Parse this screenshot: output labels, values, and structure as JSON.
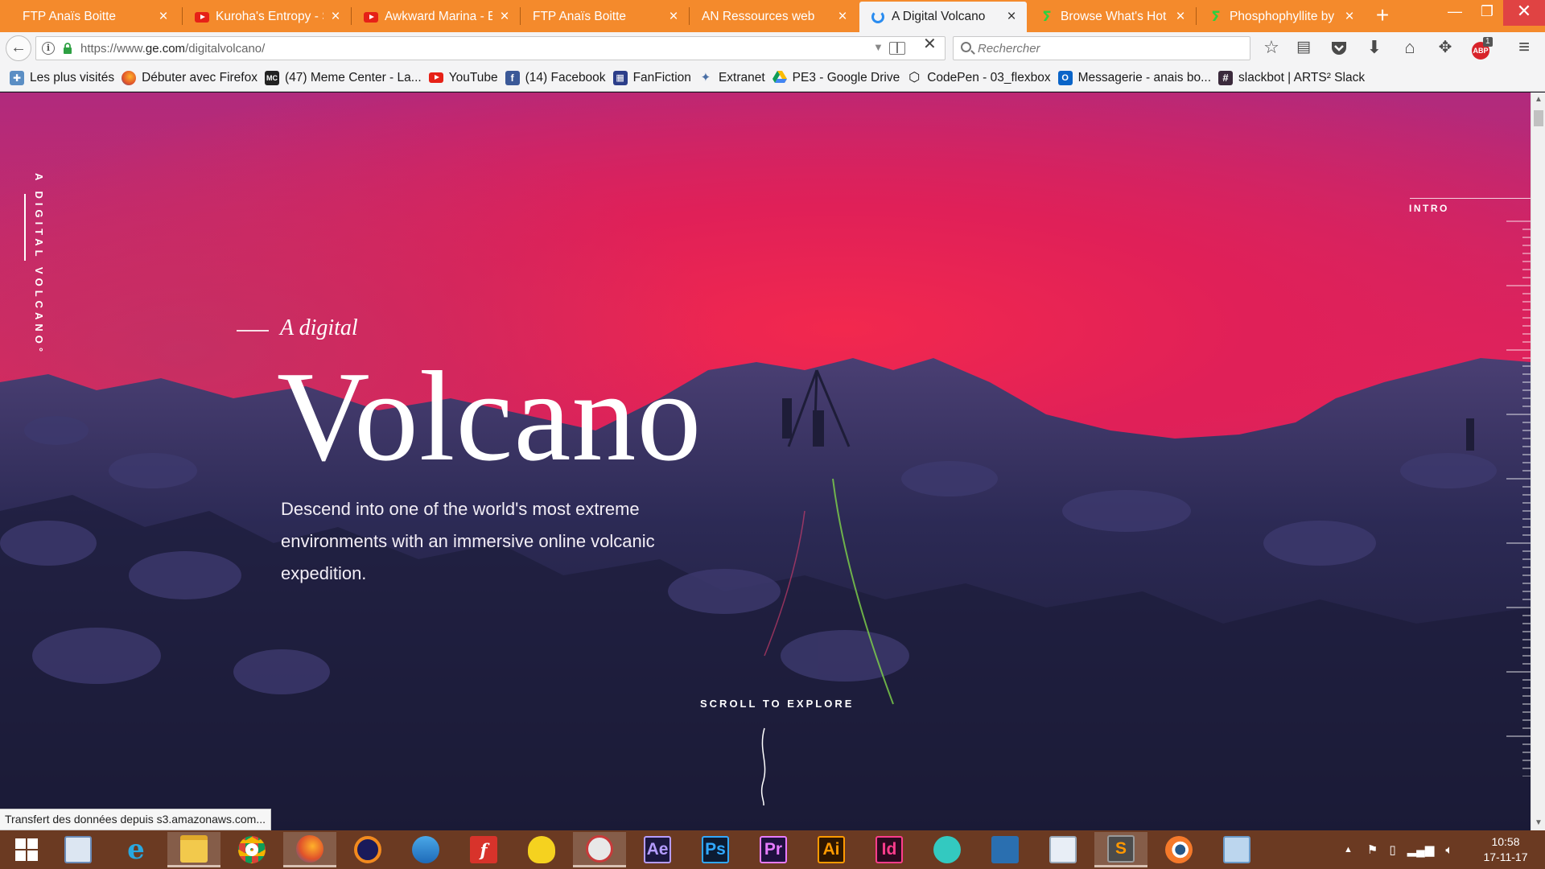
{
  "browser": {
    "tabs": [
      {
        "title": "FTP Anaïs Boitte",
        "icon": "blank-page-icon",
        "active": false
      },
      {
        "title": "Kuroha's Entropy - S",
        "icon": "youtube-icon",
        "active": false
      },
      {
        "title": "Awkward Marina - E",
        "icon": "youtube-icon",
        "active": false
      },
      {
        "title": "FTP Anaïs Boitte",
        "icon": "blank-page-icon",
        "active": false
      },
      {
        "title": "AN Ressources web",
        "icon": "blank-page-icon",
        "active": false
      },
      {
        "title": "A Digital Volcano",
        "icon": "loading-spinner-icon",
        "active": true
      },
      {
        "title": "Browse What's Hot",
        "icon": "deviantart-icon",
        "active": false
      },
      {
        "title": "Phosphophyllite by",
        "icon": "deviantart-icon",
        "active": false
      }
    ],
    "url_prefix": "https://www.",
    "url_domain": "ge.com",
    "url_path": "/digitalvolcano/",
    "search_placeholder": "Rechercher",
    "addon_badge": "1"
  },
  "bookmarks": [
    {
      "label": "Les plus visités",
      "icon": "bookmarks-folder-icon"
    },
    {
      "label": "Débuter avec Firefox",
      "icon": "firefox-icon"
    },
    {
      "label": "(47) Meme Center - La...",
      "icon": "memecenter-icon"
    },
    {
      "label": "YouTube",
      "icon": "youtube-icon"
    },
    {
      "label": "(14) Facebook",
      "icon": "facebook-icon"
    },
    {
      "label": "FanFiction",
      "icon": "fanfiction-icon"
    },
    {
      "label": "Extranet",
      "icon": "extranet-icon"
    },
    {
      "label": "PE3 - Google Drive",
      "icon": "google-drive-icon"
    },
    {
      "label": "CodePen - 03_flexbox",
      "icon": "codepen-icon"
    },
    {
      "label": "Messagerie - anais bo...",
      "icon": "outlook-icon"
    },
    {
      "label": "slackbot | ARTS² Slack",
      "icon": "slack-icon"
    }
  ],
  "page": {
    "side_brand": "A DIGITAL VOLCANO°",
    "tagline": "A digital",
    "title": "Volcano",
    "description": "Descend into one of the world's most extreme environments with an immersive online volcanic expedition.",
    "scroll_label": "SCROLL TO EXPLORE",
    "section_label": "INTRO"
  },
  "status_text": "Transfert des données depuis s3.amazonaws.com...",
  "taskbar": {
    "apps": [
      {
        "name": "start-button",
        "label": ""
      },
      {
        "name": "remote-desktop-app",
        "label": ""
      },
      {
        "name": "internet-explorer-app",
        "label": ""
      },
      {
        "name": "file-explorer-app",
        "label": ""
      },
      {
        "name": "chrome-app",
        "label": ""
      },
      {
        "name": "firefox-app",
        "label": ""
      },
      {
        "name": "audacity-app",
        "label": ""
      },
      {
        "name": "filezilla-app",
        "label": ""
      },
      {
        "name": "flash-app",
        "label": "f"
      },
      {
        "name": "cyberduck-app",
        "label": ""
      },
      {
        "name": "snipping-tool-app",
        "label": ""
      },
      {
        "name": "after-effects-app",
        "label": "Ae"
      },
      {
        "name": "photoshop-app",
        "label": "Ps"
      },
      {
        "name": "premiere-app",
        "label": "Pr"
      },
      {
        "name": "illustrator-app",
        "label": "Ai"
      },
      {
        "name": "indesign-app",
        "label": "Id"
      },
      {
        "name": "miku-app",
        "label": ""
      },
      {
        "name": "person-app",
        "label": ""
      },
      {
        "name": "image-viewer-app",
        "label": ""
      },
      {
        "name": "sublime-text-app",
        "label": "S"
      },
      {
        "name": "blender-app",
        "label": ""
      },
      {
        "name": "control-panel-app",
        "label": ""
      }
    ],
    "time": "10:58",
    "date": "17-11-17"
  },
  "colors": {
    "tabstrip": "#f48a2c",
    "taskbar": "#6b3a22",
    "lava_red": "#e6245a",
    "rock_blue": "#262548"
  }
}
